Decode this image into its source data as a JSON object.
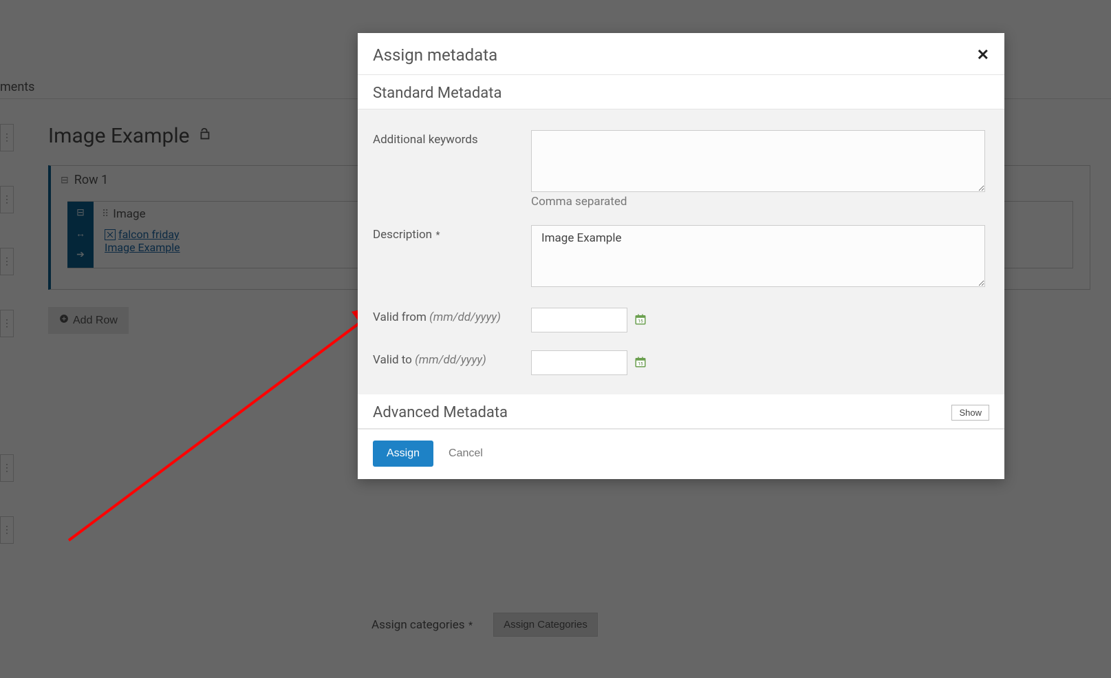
{
  "breadcrumb": {
    "tail": "ments"
  },
  "page": {
    "title": "Image Example"
  },
  "row": {
    "label": "Row 1"
  },
  "image_block": {
    "title": "Image",
    "link1": "falcon friday",
    "link2": "Image Example"
  },
  "buttons": {
    "add_row": "Add Row",
    "assign_categories": "Assign Categories"
  },
  "labels": {
    "assign_categories": "Assign categories"
  },
  "modal": {
    "title": "Assign metadata",
    "standard_heading": "Standard Metadata",
    "advanced_heading": "Advanced Metadata",
    "show_label": "Show",
    "fields": {
      "keywords": {
        "label": "Additional keywords",
        "value": "",
        "helper": "Comma separated"
      },
      "description": {
        "label": "Description",
        "value": "Image Example"
      },
      "valid_from": {
        "label_prefix": "Valid from ",
        "label_hint": "(mm/dd/yyyy)",
        "value": ""
      },
      "valid_to": {
        "label_prefix": "Valid to ",
        "label_hint": "(mm/dd/yyyy)",
        "value": ""
      }
    },
    "footer": {
      "assign": "Assign",
      "cancel": "Cancel"
    }
  }
}
